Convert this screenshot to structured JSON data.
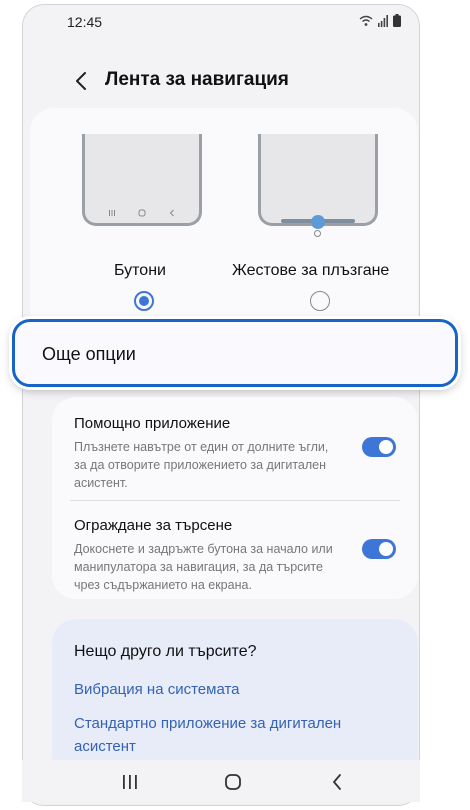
{
  "status_bar": {
    "time": "12:45"
  },
  "header": {
    "title": "Лента за навигация"
  },
  "navigation_type": {
    "options": [
      {
        "label": "Бутони",
        "selected": true
      },
      {
        "label": "Жестове за плъзгане",
        "selected": false
      }
    ]
  },
  "more_options": {
    "label": "Още опции"
  },
  "settings": [
    {
      "title": "Помощно приложение",
      "description": "Плъзнете навътре от един от долните ъгли, за да отворите приложението за дигитален асистент.",
      "enabled": true
    },
    {
      "title": "Ограждане за търсене",
      "description": "Докоснете и задръжте бутона за начало или манипулатора за навигация, за да търсите чрез съдържанието на екрана.",
      "enabled": true
    }
  ],
  "search_card": {
    "title": "Нещо друго ли търсите?",
    "links": [
      "Вибрация на системата",
      "Стандартно приложение за дигитален асистент"
    ]
  },
  "colors": {
    "accent": "#3e76d8",
    "highlight_border": "#1664c8",
    "link": "#3562b4"
  }
}
